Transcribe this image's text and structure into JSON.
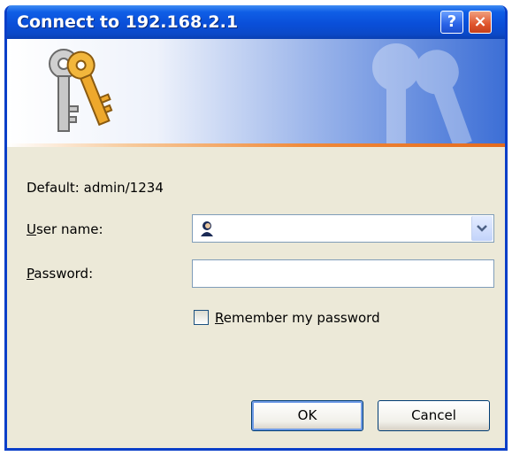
{
  "window": {
    "title": "Connect to 192.168.2.1",
    "help_button": "?",
    "close_button": "×"
  },
  "hint": "Default: admin/1234",
  "form": {
    "username_label_accel": "U",
    "username_label_rest": "ser name:",
    "username_value": "",
    "password_label_accel": "P",
    "password_label_rest": "assword:",
    "password_value": "",
    "remember_accel": "R",
    "remember_rest": "emember my password",
    "remember_checked": false
  },
  "buttons": {
    "ok": "OK",
    "cancel": "Cancel"
  },
  "icons": {
    "banner": "keys-icon",
    "username": "user-icon",
    "dropdown": "chevron-down-icon"
  }
}
